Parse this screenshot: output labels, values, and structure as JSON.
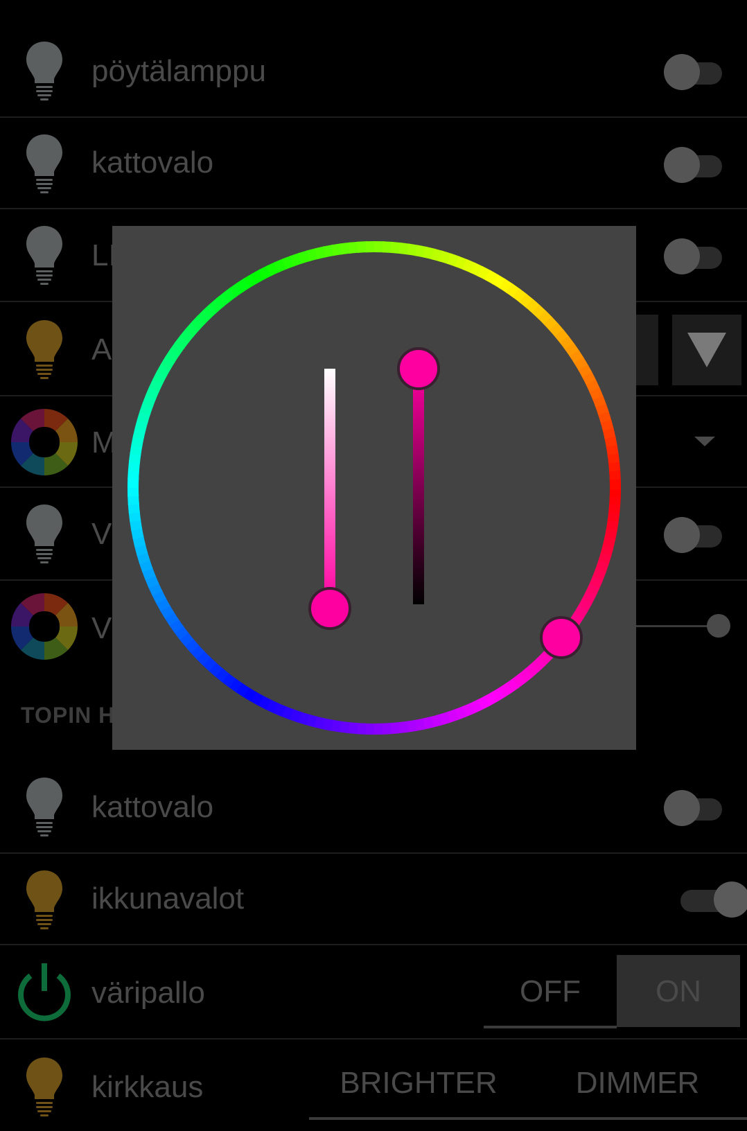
{
  "devices": [
    {
      "label": "pöytälamppu",
      "state": "off"
    },
    {
      "label": "kattovalo",
      "state": "off"
    },
    {
      "label": "LI",
      "state": "off"
    },
    {
      "label": "A"
    },
    {
      "label": "M"
    },
    {
      "label": "V",
      "state": "off"
    },
    {
      "label": "V"
    }
  ],
  "section": {
    "header": "TOPIN H"
  },
  "devices2": [
    {
      "label": "kattovalo",
      "state": "off"
    },
    {
      "label": "ikkunavalot",
      "state": "on"
    },
    {
      "label": "väripallo"
    },
    {
      "label": "kirkkaus"
    }
  ],
  "toggle_buttons": {
    "off_label": "OFF",
    "on_label": "ON",
    "selected": "ON"
  },
  "brightness_buttons": {
    "brighter_label": "BRIGHTER",
    "dimmer_label": "DIMMER"
  },
  "color_picker": {
    "selected_color": "#ff00a0",
    "saturation_slider_value": 0.06,
    "value_slider_value": 1.0
  },
  "colors": {
    "bulb_off": "#5b5f60",
    "bulb_on": "#6f5216",
    "power_icon": "#0e6b3a",
    "dialog_bg": "#434343"
  }
}
